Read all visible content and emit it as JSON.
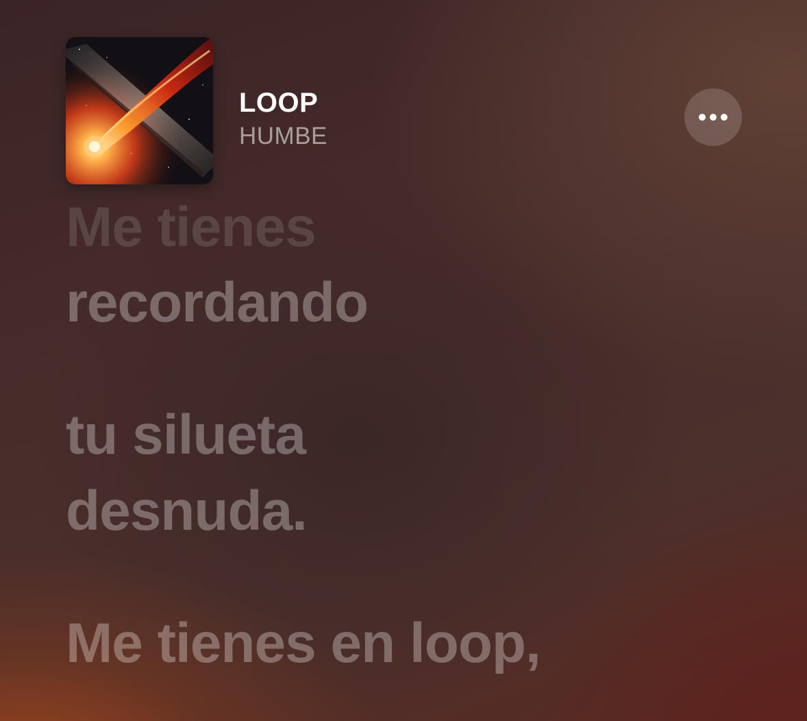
{
  "now_playing": {
    "title": "LOOP",
    "artist": "HUMBE",
    "artwork_icon": "comet-artwork",
    "more_icon": "ellipsis-icon"
  },
  "lyrics": {
    "lines": [
      "Me tienes",
      "recordando",
      "tu silueta",
      "desnuda.",
      "Me tienes en loop,"
    ]
  },
  "colors": {
    "title": "#ffffff",
    "artist": "#a99896",
    "lyric": "#7d6866",
    "background_dark": "#3b2426",
    "background_warm": "#a0461e"
  }
}
